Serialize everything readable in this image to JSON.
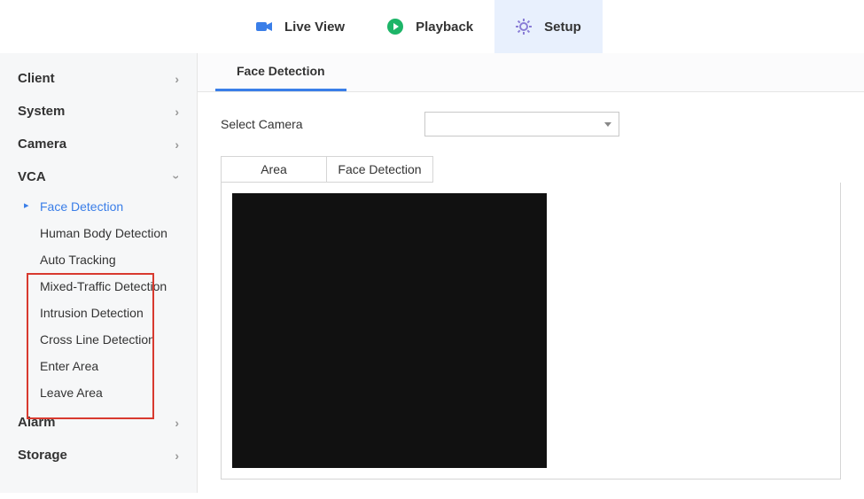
{
  "topnav": {
    "live": "Live View",
    "playback": "Playback",
    "setup": "Setup"
  },
  "sidebar": {
    "groups": {
      "client": "Client",
      "system": "System",
      "camera": "Camera",
      "vca": "VCA",
      "alarm": "Alarm",
      "storage": "Storage"
    },
    "vca_items": [
      "Face Detection",
      "Human Body Detection",
      "Auto Tracking",
      "Mixed-Traffic Detection",
      "Intrusion Detection",
      "Cross Line Detection",
      "Enter Area",
      "Leave Area"
    ]
  },
  "main": {
    "subtab": "Face Detection",
    "select_label": "Select Camera",
    "select_value": "",
    "inner_tabs": {
      "area": "Area",
      "face": "Face Detection"
    }
  }
}
